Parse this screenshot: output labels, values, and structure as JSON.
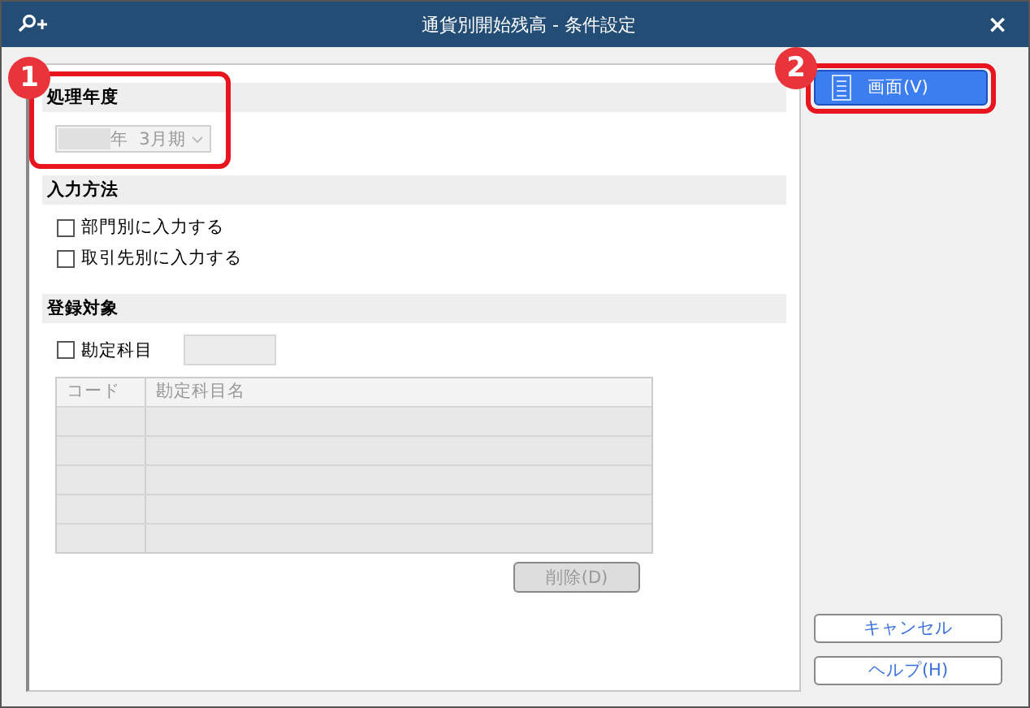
{
  "window": {
    "title": "通貨別開始残高 - 条件設定",
    "close": "×"
  },
  "fiscal_year": {
    "heading": "処理年度",
    "value": "年  3月期",
    "disabled": true
  },
  "input_method": {
    "heading": "入力方法",
    "options": [
      {
        "label": "部門別に入力する",
        "checked": false
      },
      {
        "label": "取引先別に入力する",
        "checked": false
      }
    ]
  },
  "target": {
    "heading": "登録対象",
    "account": {
      "label": "勘定科目",
      "checked": false
    },
    "table": {
      "columns": [
        "コード",
        "勘定科目名"
      ]
    },
    "delete_button": {
      "label": "削除(D)",
      "disabled": true
    }
  },
  "buttons": [
    {
      "label": "画面(V)",
      "kind": "primary"
    },
    {
      "label": "キャンセル",
      "kind": "link"
    },
    {
      "label": "ヘルプ(H)",
      "kind": "link"
    }
  ],
  "callouts": [
    "1",
    "2"
  ]
}
